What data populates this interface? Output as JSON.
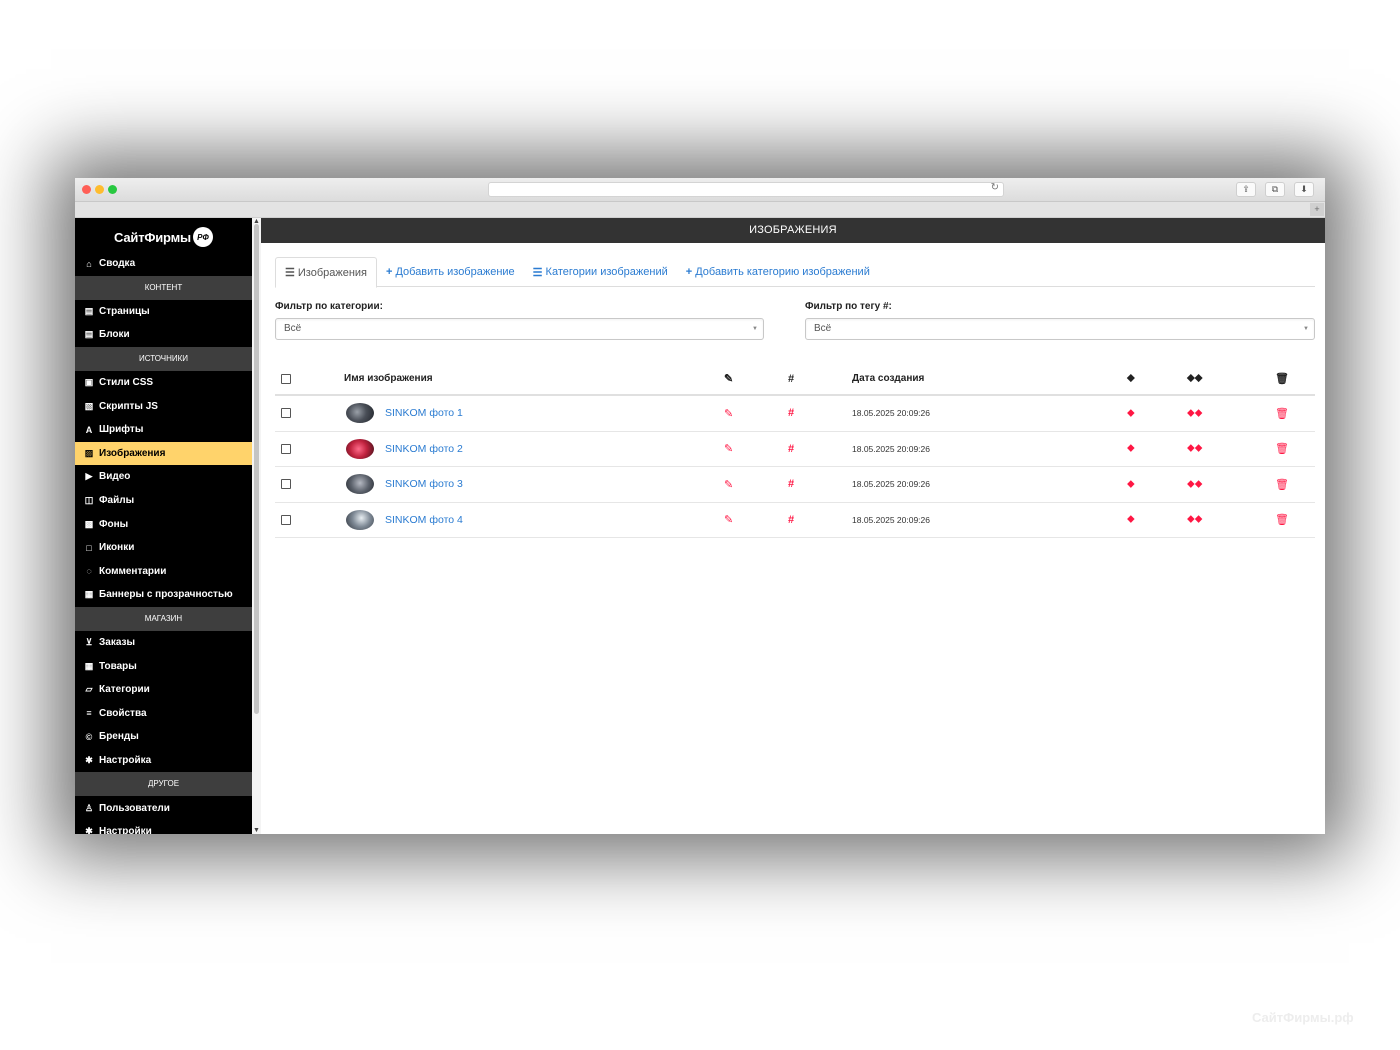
{
  "sidebar": {
    "logo_text": "СайтФирмы",
    "logo_badge": "РФ",
    "items": [
      {
        "type": "item",
        "label": "Сводка",
        "icon": "home-icon",
        "glyph": "⌂"
      },
      {
        "type": "section",
        "label": "КОНТЕНТ"
      },
      {
        "type": "item",
        "label": "Страницы",
        "icon": "file-text-icon",
        "glyph": "▤"
      },
      {
        "type": "item",
        "label": "Блоки",
        "icon": "file-text-icon",
        "glyph": "▤"
      },
      {
        "type": "section",
        "label": "ИСТОЧНИКИ"
      },
      {
        "type": "item",
        "label": "Стили CSS",
        "icon": "css-icon",
        "glyph": "▣"
      },
      {
        "type": "item",
        "label": "Скрипты JS",
        "icon": "code-file-icon",
        "glyph": "▧"
      },
      {
        "type": "item",
        "label": "Шрифты",
        "icon": "font-icon",
        "glyph": "A"
      },
      {
        "type": "item",
        "label": "Изображения",
        "icon": "image-file-icon",
        "glyph": "▨",
        "active": true
      },
      {
        "type": "item",
        "label": "Видео",
        "icon": "video-file-icon",
        "glyph": "▶"
      },
      {
        "type": "item",
        "label": "Файлы",
        "icon": "files-icon",
        "glyph": "◫"
      },
      {
        "type": "item",
        "label": "Фоны",
        "icon": "picture-icon",
        "glyph": "▩"
      },
      {
        "type": "item",
        "label": "Иконки",
        "icon": "square-icon",
        "glyph": "□"
      },
      {
        "type": "item",
        "label": "Комментарии",
        "icon": "comment-icon",
        "glyph": "◌"
      },
      {
        "type": "item",
        "label": "Баннеры с прозрачностью",
        "icon": "banner-icon",
        "glyph": "▦"
      },
      {
        "type": "section",
        "label": "МАГАЗИН"
      },
      {
        "type": "item",
        "label": "Заказы",
        "icon": "cart-icon",
        "glyph": "⊻"
      },
      {
        "type": "item",
        "label": "Товары",
        "icon": "grid-icon",
        "glyph": "▦"
      },
      {
        "type": "item",
        "label": "Категории",
        "icon": "folder-icon",
        "glyph": "▱"
      },
      {
        "type": "item",
        "label": "Свойства",
        "icon": "sliders-icon",
        "glyph": "≡"
      },
      {
        "type": "item",
        "label": "Бренды",
        "icon": "copyright-icon",
        "glyph": "©"
      },
      {
        "type": "item",
        "label": "Настройка",
        "icon": "gear-icon",
        "glyph": "✱"
      },
      {
        "type": "section",
        "label": "ДРУГОЕ"
      },
      {
        "type": "item",
        "label": "Пользователи",
        "icon": "user-icon",
        "glyph": "♙"
      },
      {
        "type": "item",
        "label": "Настройки",
        "icon": "gear-icon",
        "glyph": "✱"
      }
    ]
  },
  "header": {
    "title": "ИЗОБРАЖЕНИЯ"
  },
  "tabs": [
    {
      "label": "Изображения",
      "glyph": "☰",
      "icon": "list-icon",
      "active": true
    },
    {
      "label": "Добавить изображение",
      "glyph": "+",
      "icon": "plus-icon"
    },
    {
      "label": "Категории изображений",
      "glyph": "☰",
      "icon": "list-icon"
    },
    {
      "label": "Добавить категорию изображений",
      "glyph": "+",
      "icon": "plus-icon"
    }
  ],
  "filters": {
    "category": {
      "label": "Фильтр по категории:",
      "value": "Всё"
    },
    "tag": {
      "label": "Фильтр по тегу #:",
      "value": "Всё"
    }
  },
  "table": {
    "headers": {
      "name": "Имя изображения",
      "date": "Дата создания"
    },
    "rows": [
      {
        "name": "SINKOM фото 1",
        "date": "18.05.2025 20:09:26"
      },
      {
        "name": "SINKOM фото 2",
        "date": "18.05.2025 20:09:26"
      },
      {
        "name": "SINKOM фото 3",
        "date": "18.05.2025 20:09:26"
      },
      {
        "name": "SINKOM фото 4",
        "date": "18.05.2025 20:09:26"
      }
    ]
  },
  "colors": {
    "accent_link": "#2a7bd1",
    "action_red": "#ff1744",
    "active_nav": "#ffd36b",
    "header_bg": "#333333"
  },
  "watermark": "СайтФирмы.рф"
}
